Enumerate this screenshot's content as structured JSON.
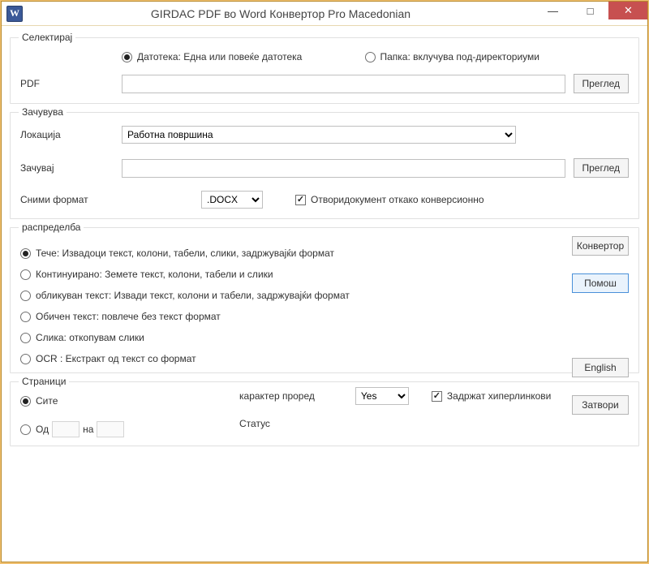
{
  "title": "GIRDAC PDF во Word Конвертор Pro Macedonian",
  "btn_min": "—",
  "btn_max": "□",
  "btn_close": "✕",
  "select": {
    "legend": "Селектирај",
    "opt_file": "Датотека: Една или повеќе датотека",
    "opt_folder": "Папка: вклучува под-директориуми",
    "pdf_label": "PDF",
    "browse": "Преглед"
  },
  "save": {
    "legend": "Зачувува",
    "location_label": "Локација",
    "location_value": "Работна површина",
    "save_label": "Зачувај",
    "browse": "Преглед",
    "format_label": "Сними формат",
    "format_value": ".DOCX",
    "open_after": "Отворидокумент откако конверсионно"
  },
  "dist": {
    "legend": "распределба",
    "r1": "Тече: Извадоци текст, колони, табели, слики, задржувајќи формат",
    "r2": "Континуирано: Земете текст, колони, табели и слики",
    "r3": "обликуван текст: Извади текст, колони и табели, задржувајќи формат",
    "r4": "Обичен текст: повлече без текст формат",
    "r5": "Слика: откопувам слики",
    "r6": "OCR :  Екстракт од текст со формат",
    "btn_convert": "Конвертор",
    "btn_help": "Помош",
    "btn_english": "English",
    "btn_close": "Затвори"
  },
  "pages": {
    "legend": "Страници",
    "all": "Сите",
    "from": "Од",
    "to": "на",
    "charspace_label": "карактер проред",
    "charspace_value": "Yes",
    "keep_links": "Задржат хиперлинкови",
    "status_label": "Статус"
  }
}
